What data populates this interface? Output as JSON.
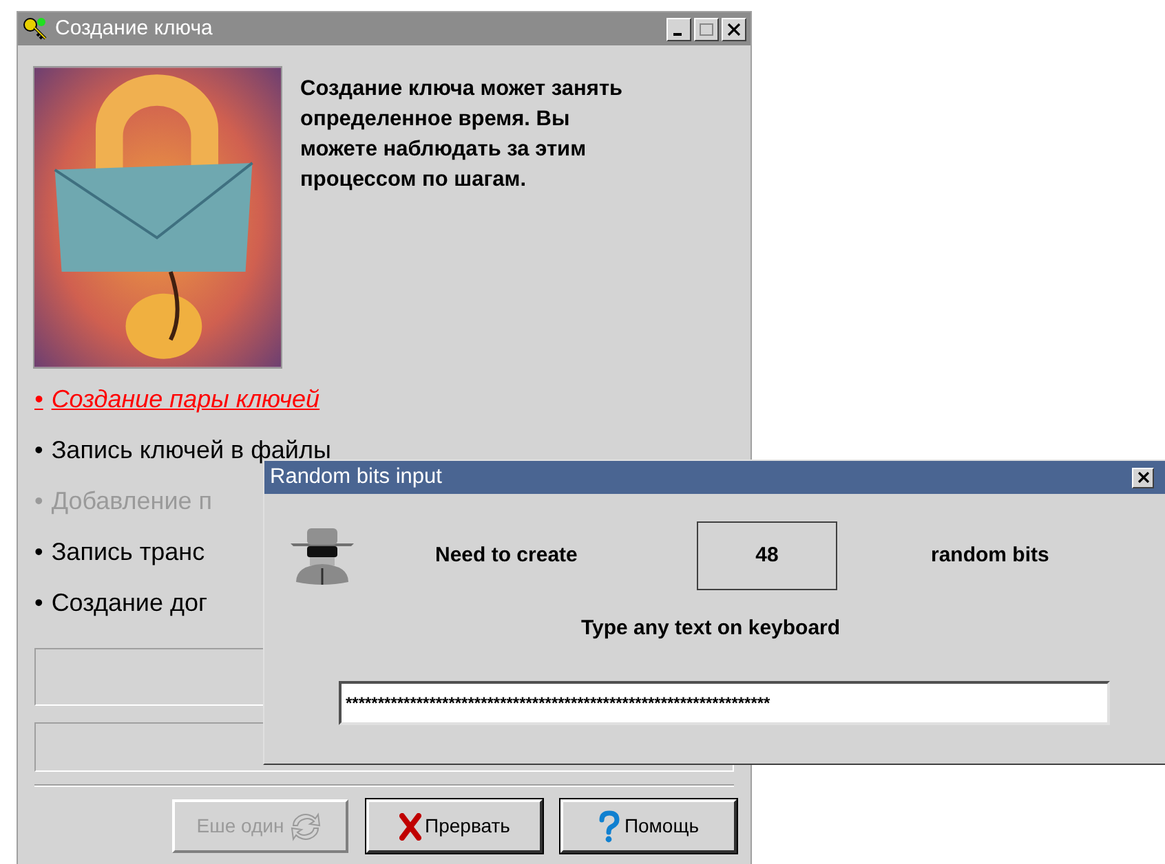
{
  "main_window": {
    "title": "Создание ключа",
    "description": "Создание ключа может занять определенное время. Вы можете наблюдать за этим процессом по шагам.",
    "steps": [
      {
        "bullet": "•",
        "label": "Создание пары ключей",
        "selected": true,
        "disabled": false
      },
      {
        "bullet": "•",
        "label": "Запись ключей в файлы",
        "selected": false,
        "disabled": false
      },
      {
        "bullet": "•",
        "label": "Добавление п",
        "selected": false,
        "disabled": true
      },
      {
        "bullet": "•",
        "label": "Запись транс",
        "selected": false,
        "disabled": false
      },
      {
        "bullet": "•",
        "label": "Создание дог",
        "selected": false,
        "disabled": false
      }
    ],
    "buttons": [
      {
        "kind": "repeat",
        "label": "Еше один",
        "disabled": true
      },
      {
        "kind": "abort",
        "label": "Прервать",
        "disabled": false
      },
      {
        "kind": "help",
        "label": "Помощь",
        "disabled": false
      }
    ]
  },
  "dialog": {
    "title": "Random bits input",
    "need_label": "Need to create",
    "count": "48",
    "unit_label": "random bits",
    "instruction": "Type any text on keyboard",
    "input_value": "******************************************************************"
  }
}
